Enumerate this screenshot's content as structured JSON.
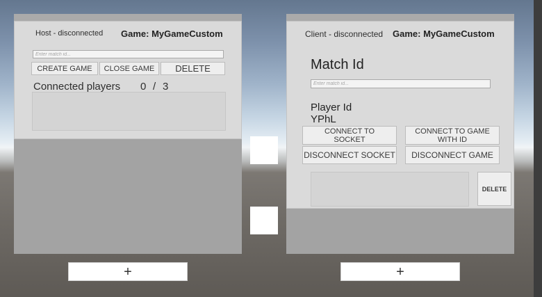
{
  "host": {
    "status": "Host - disconnected",
    "game_label": "Game: MyGameCustom",
    "match_input_placeholder": "Enter match id...",
    "create_game": "CREATE GAME",
    "close_game": "CLOSE GAME",
    "delete": "DELETE",
    "connected_players_label": "Connected players",
    "players_current": "0",
    "players_separator": "/",
    "players_max": "3",
    "add_button": "+"
  },
  "client": {
    "status": "Client - disconnected",
    "game_label": "Game: MyGameCustom",
    "match_id_heading": "Match Id",
    "match_input_placeholder": "Enter match id...",
    "player_id_label": "Player Id",
    "player_id_value": "YPhL",
    "connect_socket": "CONNECT TO SOCKET",
    "connect_game_with_id": "CONNECT TO GAME WITH ID",
    "disconnect_socket": "DISCONNECT SOCKET",
    "disconnect_game": "DISCONNECT GAME",
    "delete": "DELETE",
    "add_button": "+"
  }
}
